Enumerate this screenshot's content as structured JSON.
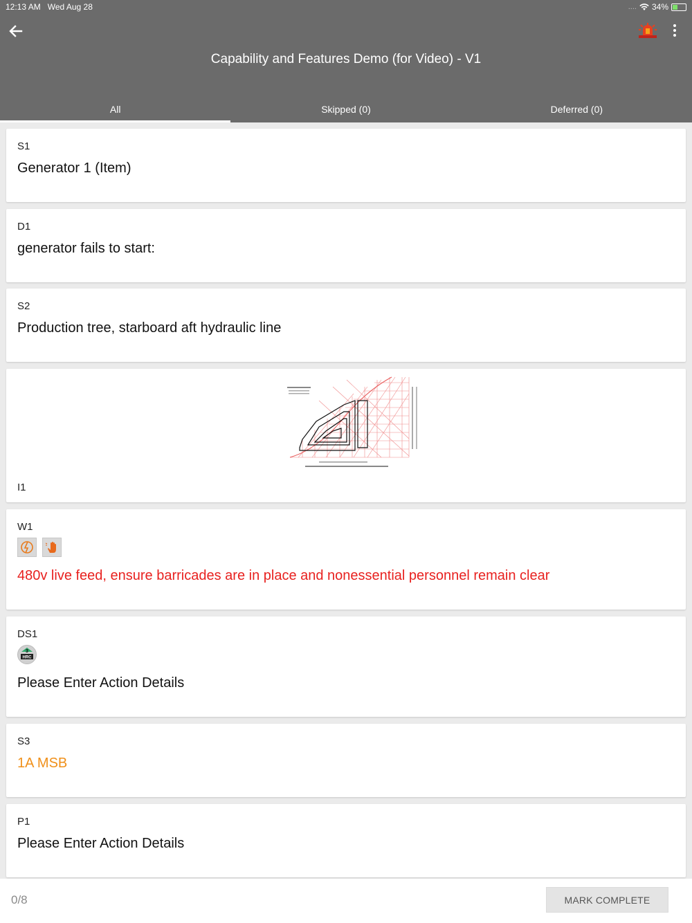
{
  "status_bar": {
    "time": "12:13 AM",
    "date": "Wed Aug 28",
    "signal": "....",
    "battery": "34%"
  },
  "header": {
    "title": "Capability and Features Demo (for Video) - V1"
  },
  "tabs": [
    {
      "label": "All",
      "active": true
    },
    {
      "label": "Skipped (0)",
      "active": false
    },
    {
      "label": "Deferred (0)",
      "active": false
    }
  ],
  "cards": [
    {
      "code": "S1",
      "text": "Generator 1 (Item)"
    },
    {
      "code": "D1",
      "text": "generator fails to start:"
    },
    {
      "code": "S2",
      "text": "Production tree, starboard aft hydraulic line"
    },
    {
      "code": "I1",
      "image": "psychrometric-chart-thumbnail"
    },
    {
      "code": "W1",
      "text": "480v live feed, ensure barricades are in place and nonessential personnel remain clear",
      "icons": [
        "electrical-hazard-icon",
        "hand-hazard-icon"
      ],
      "color": "#e8211f"
    },
    {
      "code": "DS1",
      "text": "Please Enter Action Details",
      "badge": {
        "number": "3",
        "label": "HRC"
      }
    },
    {
      "code": "S3",
      "text": "1A MSB",
      "color": "#f0901a"
    },
    {
      "code": "P1",
      "text": "Please Enter Action Details"
    }
  ],
  "footer": {
    "progress": "0/8",
    "button": "MARK COMPLETE"
  },
  "colors": {
    "header_bg": "#6b6b6b",
    "page_bg": "#ebebeb",
    "warning_red": "#e8211f",
    "accent_orange": "#f0901a"
  }
}
